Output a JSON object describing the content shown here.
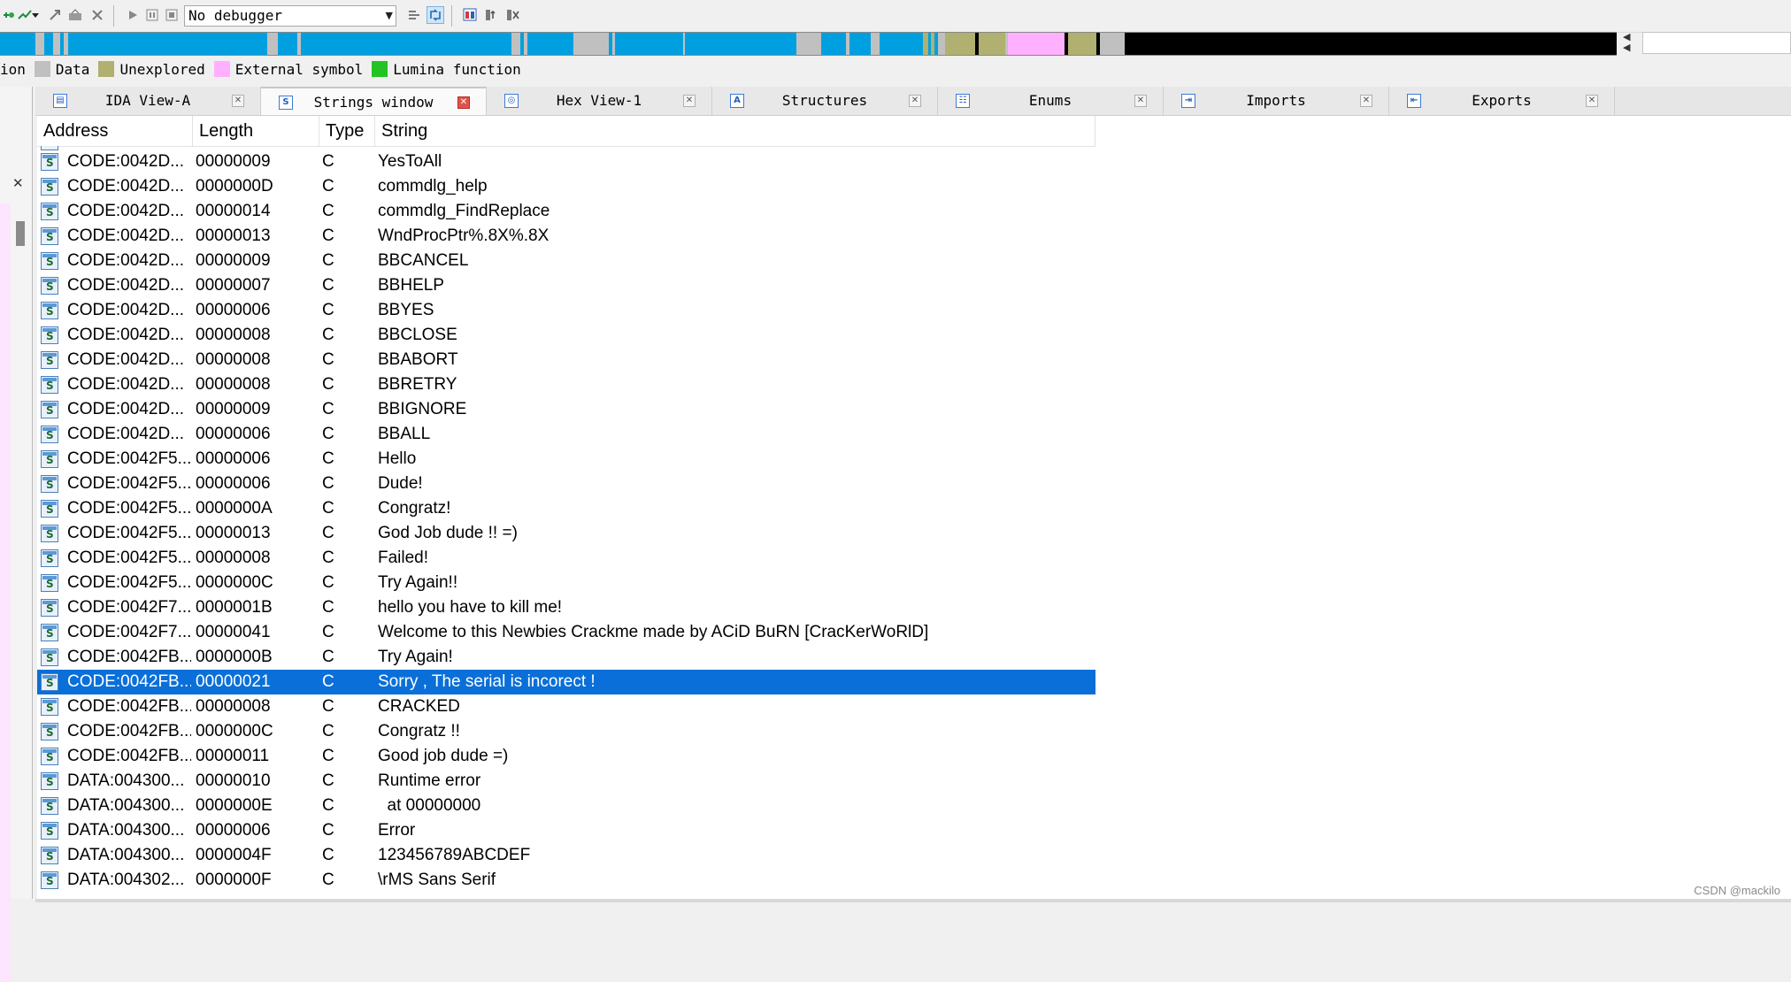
{
  "toolbar": {
    "debugger_select": "No debugger",
    "icons": [
      "add-breakpoint-icon",
      "dropdown-arrow-icon",
      "toggle-icon",
      "trace-icon",
      "close-icon",
      "start-process-icon",
      "pause-icon",
      "stop-icon",
      "graph-icon",
      "refresh-icon",
      "view-icon",
      "trace-options-icon",
      "pointer-icon"
    ]
  },
  "nav_colors": {
    "code": "#00a0e0",
    "data": "#c0c0c0",
    "unexplored": "#b0b070",
    "external": "#ffb0ff",
    "black": "#000000",
    "lumina": "#22c422"
  },
  "legend": {
    "items": [
      {
        "label": "ion",
        "color": ""
      },
      {
        "label": "Data",
        "color": "#c0c0c0"
      },
      {
        "label": "Unexplored",
        "color": "#b0b070"
      },
      {
        "label": "External symbol",
        "color": "#ffb0ff"
      },
      {
        "label": "Lumina function",
        "color": "#22c422"
      }
    ]
  },
  "tabs": [
    {
      "label": "IDA View-A",
      "icon": "ida-view-icon"
    },
    {
      "label": "Strings window",
      "icon": "strings-icon"
    },
    {
      "label": "Hex View-1",
      "icon": "hex-view-icon"
    },
    {
      "label": "Structures",
      "icon": "structures-icon"
    },
    {
      "label": "Enums",
      "icon": "enums-icon"
    },
    {
      "label": "Imports",
      "icon": "imports-icon"
    },
    {
      "label": "Exports",
      "icon": "exports-icon"
    }
  ],
  "strings_table": {
    "columns": [
      "Address",
      "Length",
      "Type",
      "String"
    ],
    "rows": [
      {
        "address": "CODE:0042D...",
        "length": "00000009",
        "type": "C",
        "string": "YesToAll"
      },
      {
        "address": "CODE:0042D...",
        "length": "0000000D",
        "type": "C",
        "string": "commdlg_help"
      },
      {
        "address": "CODE:0042D...",
        "length": "00000014",
        "type": "C",
        "string": "commdlg_FindReplace"
      },
      {
        "address": "CODE:0042D...",
        "length": "00000013",
        "type": "C",
        "string": "WndProcPtr%.8X%.8X"
      },
      {
        "address": "CODE:0042D...",
        "length": "00000009",
        "type": "C",
        "string": "BBCANCEL"
      },
      {
        "address": "CODE:0042D...",
        "length": "00000007",
        "type": "C",
        "string": "BBHELP"
      },
      {
        "address": "CODE:0042D...",
        "length": "00000006",
        "type": "C",
        "string": "BBYES"
      },
      {
        "address": "CODE:0042D...",
        "length": "00000008",
        "type": "C",
        "string": "BBCLOSE"
      },
      {
        "address": "CODE:0042D...",
        "length": "00000008",
        "type": "C",
        "string": "BBABORT"
      },
      {
        "address": "CODE:0042D...",
        "length": "00000008",
        "type": "C",
        "string": "BBRETRY"
      },
      {
        "address": "CODE:0042D...",
        "length": "00000009",
        "type": "C",
        "string": "BBIGNORE"
      },
      {
        "address": "CODE:0042D...",
        "length": "00000006",
        "type": "C",
        "string": "BBALL"
      },
      {
        "address": "CODE:0042F5...",
        "length": "00000006",
        "type": "C",
        "string": "Hello"
      },
      {
        "address": "CODE:0042F5...",
        "length": "00000006",
        "type": "C",
        "string": "Dude!"
      },
      {
        "address": "CODE:0042F5...",
        "length": "0000000A",
        "type": "C",
        "string": "Congratz!"
      },
      {
        "address": "CODE:0042F5...",
        "length": "00000013",
        "type": "C",
        "string": "God Job dude !! =)"
      },
      {
        "address": "CODE:0042F5...",
        "length": "00000008",
        "type": "C",
        "string": "Failed!"
      },
      {
        "address": "CODE:0042F5...",
        "length": "0000000C",
        "type": "C",
        "string": "Try Again!!"
      },
      {
        "address": "CODE:0042F7...",
        "length": "0000001B",
        "type": "C",
        "string": "hello you have to kill me!"
      },
      {
        "address": "CODE:0042F7...",
        "length": "00000041",
        "type": "C",
        "string": "Welcome to this Newbies Crackme made by ACiD BuRN [CracKerWoRlD]"
      },
      {
        "address": "CODE:0042FB...",
        "length": "0000000B",
        "type": "C",
        "string": "Try Again!"
      },
      {
        "address": "CODE:0042FB...",
        "length": "00000021",
        "type": "C",
        "string": "Sorry , The serial is incorect !",
        "selected": true
      },
      {
        "address": "CODE:0042FB...",
        "length": "00000008",
        "type": "C",
        "string": "CRACKED"
      },
      {
        "address": "CODE:0042FB...",
        "length": "0000000C",
        "type": "C",
        "string": "Congratz !!"
      },
      {
        "address": "CODE:0042FB...",
        "length": "00000011",
        "type": "C",
        "string": "Good job dude =)"
      },
      {
        "address": "DATA:004300...",
        "length": "00000010",
        "type": "C",
        "string": "Runtime error"
      },
      {
        "address": "DATA:004300...",
        "length": "0000000E",
        "type": "C",
        "string": "  at 00000000"
      },
      {
        "address": "DATA:004300...",
        "length": "00000006",
        "type": "C",
        "string": "Error"
      },
      {
        "address": "DATA:004300...",
        "length": "0000004F",
        "type": "C",
        "string": "123456789ABCDEF"
      },
      {
        "address": "DATA:004302...",
        "length": "0000000F",
        "type": "C",
        "string": "\\rMS Sans Serif"
      }
    ]
  },
  "watermark": "CSDN @mackilo"
}
